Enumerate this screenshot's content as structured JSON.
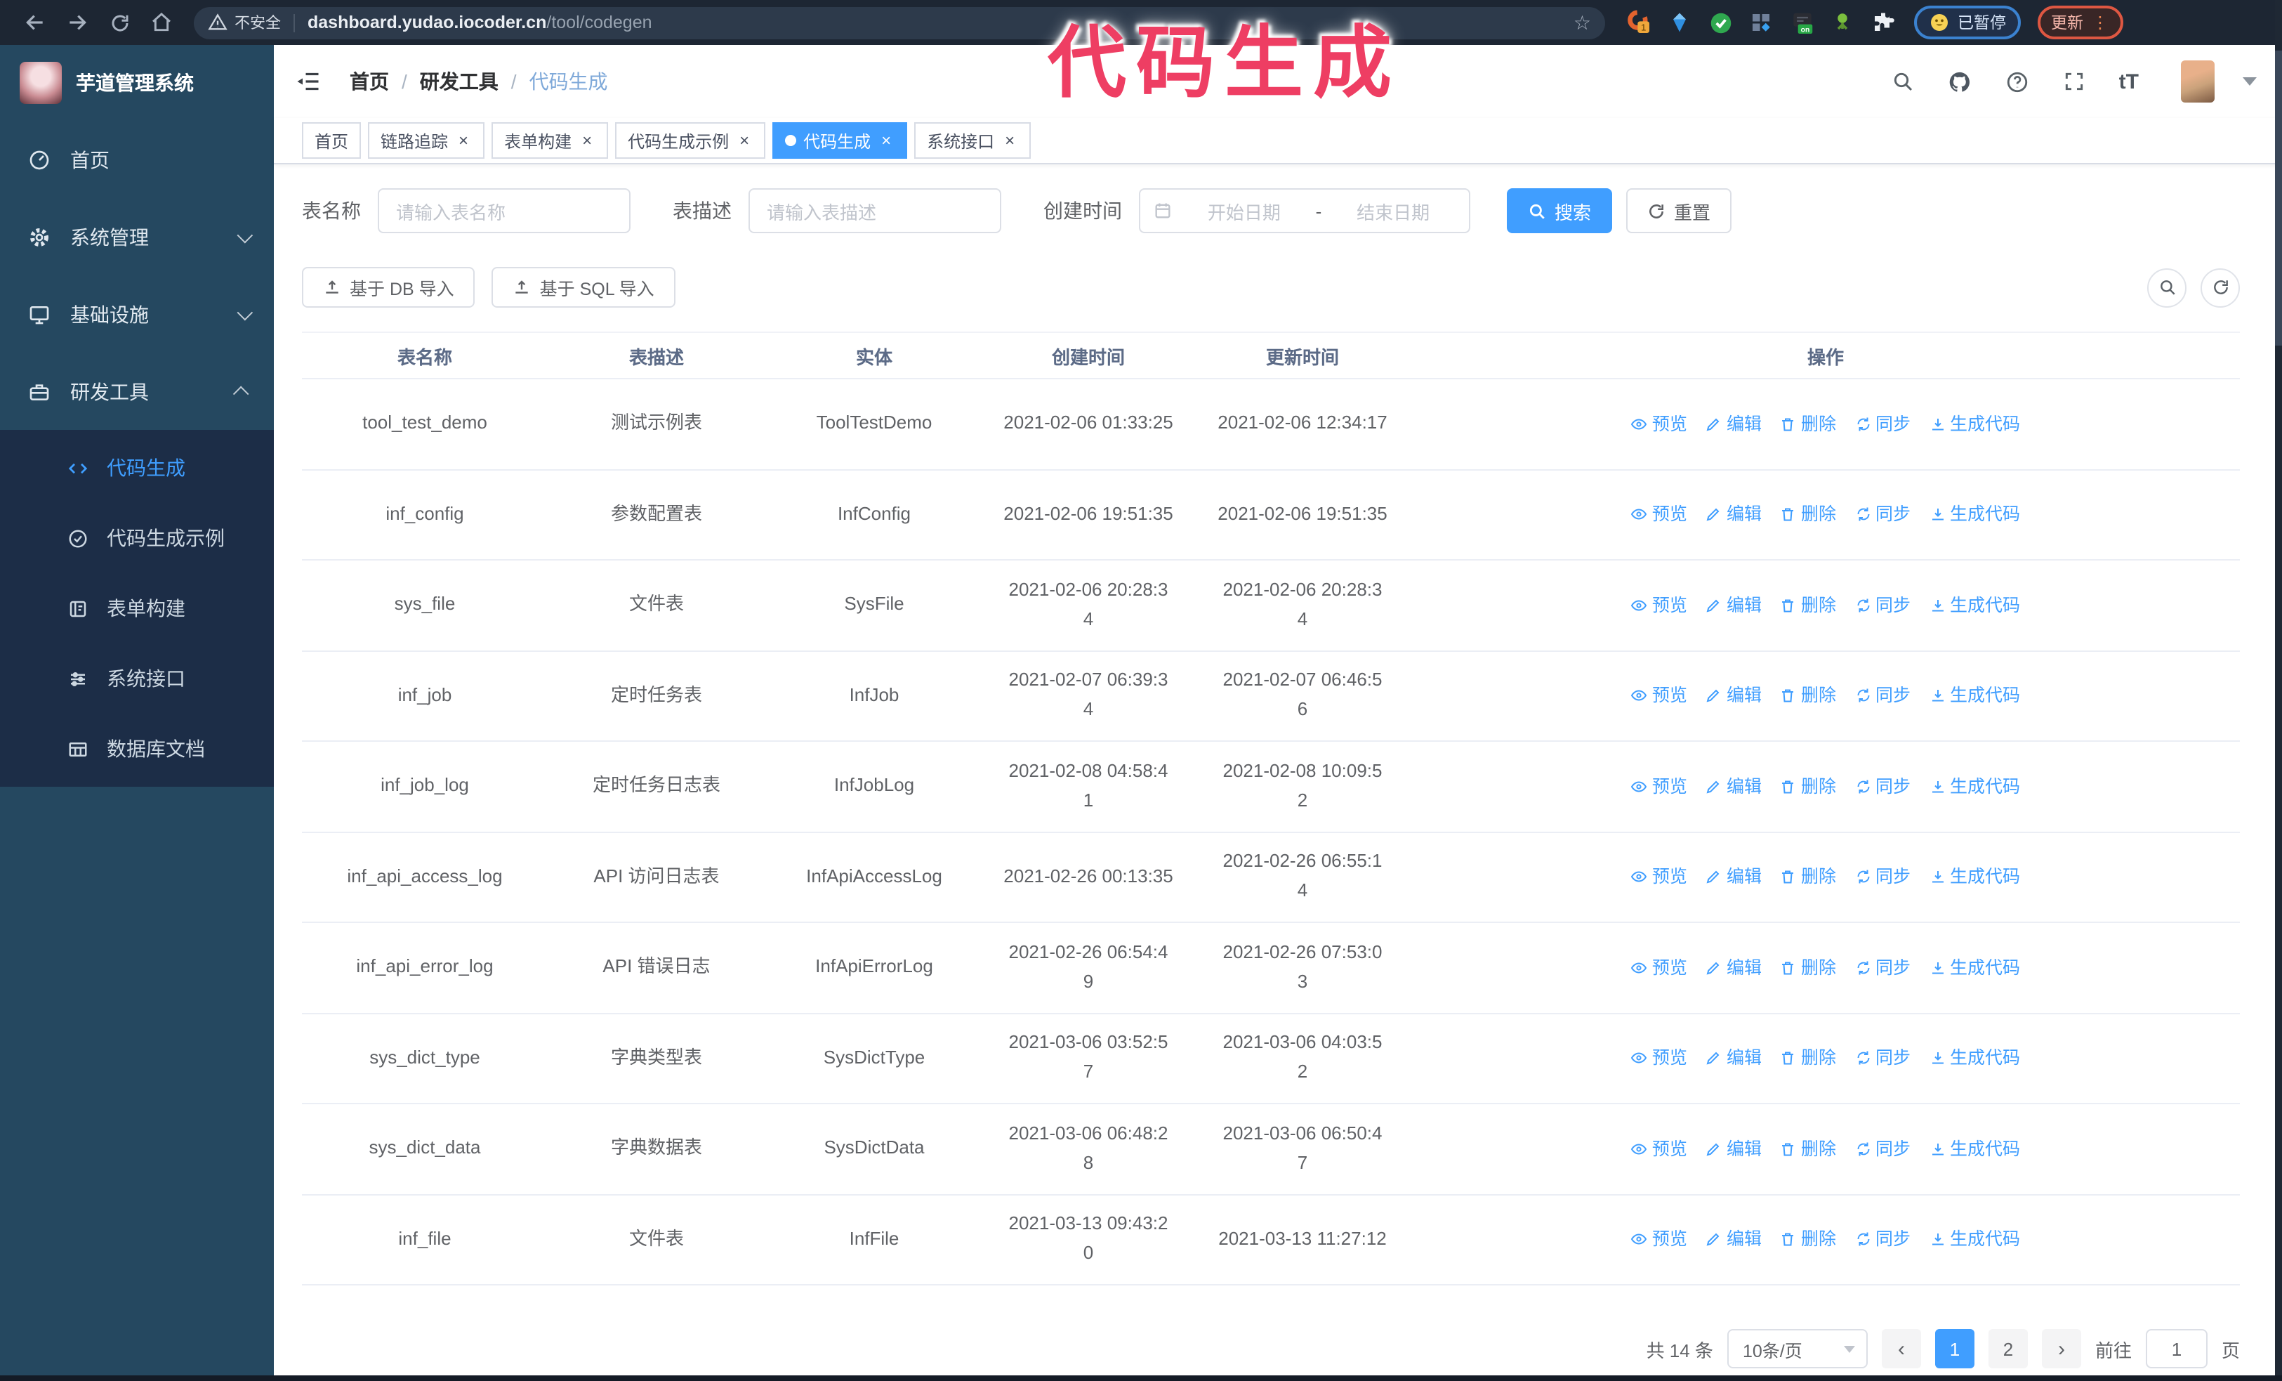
{
  "browser": {
    "security_label": "不安全",
    "url_host": "dashboard.yudao.iocoder.cn",
    "url_path": "/tool/codegen",
    "extension_badge": "1",
    "extension_on_badge": "on",
    "paused_label": "已暂停",
    "update_label": "更新"
  },
  "annotation": {
    "text": "代码生成",
    "color": "#ee3e63"
  },
  "sidebar": {
    "logo_title": "芋道管理系统",
    "items": [
      {
        "label": "首页"
      },
      {
        "label": "系统管理"
      },
      {
        "label": "基础设施"
      },
      {
        "label": "研发工具"
      }
    ],
    "sub_items": [
      {
        "label": "代码生成",
        "active": true
      },
      {
        "label": "代码生成示例"
      },
      {
        "label": "表单构建"
      },
      {
        "label": "系统接口"
      },
      {
        "label": "数据库文档"
      }
    ]
  },
  "header": {
    "breadcrumb": [
      "首页",
      "研发工具",
      "代码生成"
    ]
  },
  "tabs": [
    {
      "label": "首页"
    },
    {
      "label": "链路追踪"
    },
    {
      "label": "表单构建"
    },
    {
      "label": "代码生成示例"
    },
    {
      "label": "代码生成",
      "active": true
    },
    {
      "label": "系统接口"
    }
  ],
  "search": {
    "name_label": "表名称",
    "name_placeholder": "请输入表名称",
    "desc_label": "表描述",
    "desc_placeholder": "请输入表描述",
    "time_label": "创建时间",
    "start_placeholder": "开始日期",
    "range_separator": "-",
    "end_placeholder": "结束日期",
    "search_label": "搜索",
    "reset_label": "重置"
  },
  "toolbar": {
    "import_db_label": "基于 DB 导入",
    "import_sql_label": "基于 SQL 导入"
  },
  "table": {
    "headers": [
      "表名称",
      "表描述",
      "实体",
      "创建时间",
      "更新时间",
      "操作"
    ],
    "action_labels": [
      "预览",
      "编辑",
      "删除",
      "同步",
      "生成代码"
    ],
    "rows": [
      {
        "name": "tool_test_demo",
        "desc": "测试示例表",
        "entity": "ToolTestDemo",
        "created": "2021-02-06 01:33:25",
        "updated": "2021-02-06 12:34:17"
      },
      {
        "name": "inf_config",
        "desc": "参数配置表",
        "entity": "InfConfig",
        "created": "2021-02-06 19:51:35",
        "updated": "2021-02-06 19:51:35"
      },
      {
        "name": "sys_file",
        "desc": "文件表",
        "entity": "SysFile",
        "created": "2021-02-06 20:28:3\n4",
        "updated": "2021-02-06 20:28:3\n4"
      },
      {
        "name": "inf_job",
        "desc": "定时任务表",
        "entity": "InfJob",
        "created": "2021-02-07 06:39:3\n4",
        "updated": "2021-02-07 06:46:5\n6"
      },
      {
        "name": "inf_job_log",
        "desc": "定时任务日志表",
        "entity": "InfJobLog",
        "created": "2021-02-08 04:58:4\n1",
        "updated": "2021-02-08 10:09:5\n2"
      },
      {
        "name": "inf_api_access_log",
        "desc": "API 访问日志表",
        "entity": "InfApiAccessLog",
        "created": "2021-02-26 00:13:35",
        "updated": "2021-02-26 06:55:1\n4"
      },
      {
        "name": "inf_api_error_log",
        "desc": "API 错误日志",
        "entity": "InfApiErrorLog",
        "created": "2021-02-26 06:54:4\n9",
        "updated": "2021-02-26 07:53:0\n3"
      },
      {
        "name": "sys_dict_type",
        "desc": "字典类型表",
        "entity": "SysDictType",
        "created": "2021-03-06 03:52:5\n7",
        "updated": "2021-03-06 04:03:5\n2"
      },
      {
        "name": "sys_dict_data",
        "desc": "字典数据表",
        "entity": "SysDictData",
        "created": "2021-03-06 06:48:2\n8",
        "updated": "2021-03-06 06:50:4\n7"
      },
      {
        "name": "inf_file",
        "desc": "文件表",
        "entity": "InfFile",
        "created": "2021-03-13 09:43:2\n0",
        "updated": "2021-03-13 11:27:12"
      }
    ]
  },
  "pagination": {
    "total": "共 14 条",
    "page_size": "10条/页",
    "pages": [
      "1",
      "2"
    ],
    "active_page": "1",
    "goto_label": "前往",
    "goto_value": "1",
    "page_unit": "页"
  },
  "colors": {
    "primary": "#409eff",
    "sidebar_bg": "#254860",
    "submenu_bg": "#1c2d47",
    "annotation": "#ee3e63"
  }
}
